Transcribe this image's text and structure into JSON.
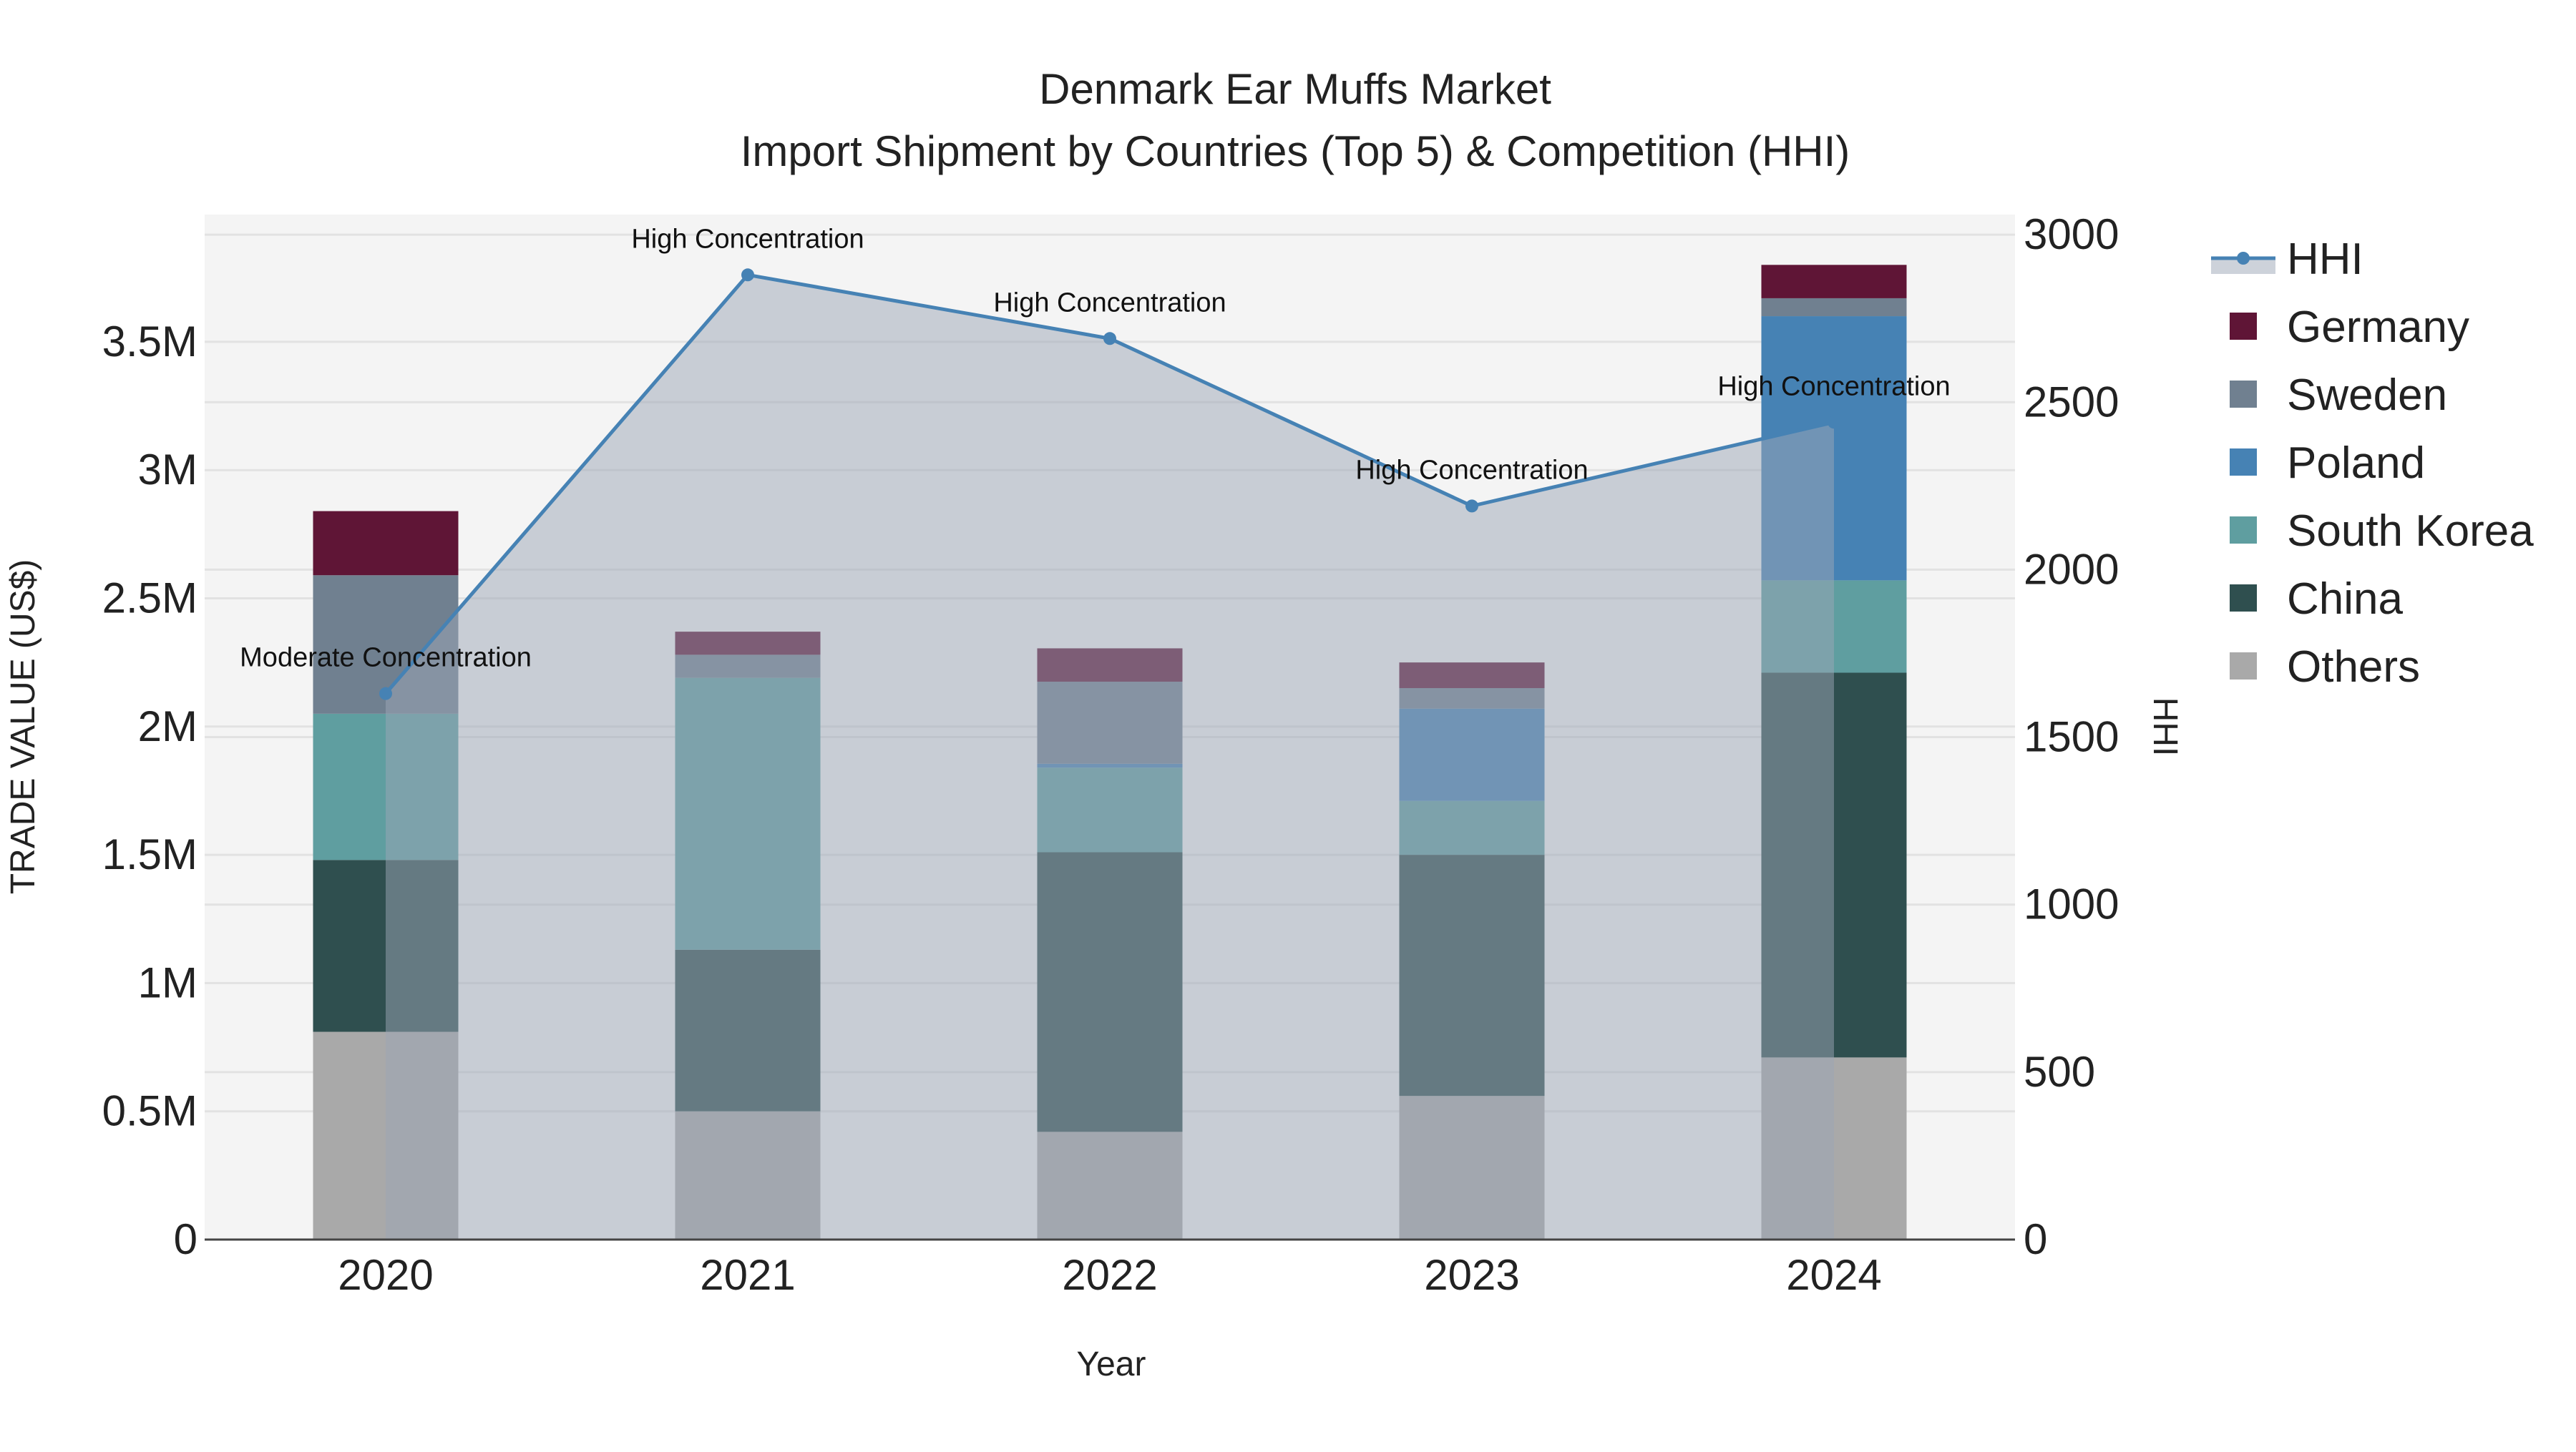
{
  "chart_data": {
    "type": "bar",
    "title": "Denmark Ear Muffs Market",
    "subtitle": "Import Shipment by Countries (Top 5) & Competition (HHI)",
    "xlabel": "Year",
    "ylabel": "TRADE VALUE (US$)",
    "y2label": "HHI",
    "categories": [
      "2020",
      "2021",
      "2022",
      "2023",
      "2024"
    ],
    "ylim": [
      0,
      3900000
    ],
    "y2lim": [
      0,
      3050
    ],
    "y_ticks": [
      0,
      500000,
      1000000,
      1500000,
      2000000,
      2500000,
      3000000,
      3500000
    ],
    "y_tick_labels": [
      "0",
      "0.5M",
      "1M",
      "1.5M",
      "2M",
      "2.5M",
      "3M",
      "3.5M"
    ],
    "y2_ticks": [
      0,
      500,
      1000,
      1500,
      2000,
      2500,
      3000
    ],
    "y2_tick_labels": [
      "0",
      "500",
      "1000",
      "1500",
      "2000",
      "2500",
      "3000"
    ],
    "series": [
      {
        "name": "Others",
        "color": "#a9a9a9",
        "values": [
          810000,
          500000,
          420000,
          560000,
          710000
        ]
      },
      {
        "name": "China",
        "color": "#2f4f4f",
        "values": [
          670000,
          630000,
          1090000,
          940000,
          1500000
        ]
      },
      {
        "name": "South Korea",
        "color": "#5f9ea0",
        "values": [
          570000,
          1060000,
          330000,
          210000,
          360000
        ]
      },
      {
        "name": "Poland",
        "color": "#4682b4",
        "values": [
          0,
          0,
          15000,
          360000,
          1030000
        ]
      },
      {
        "name": "Sweden",
        "color": "#708090",
        "values": [
          540000,
          90000,
          320000,
          80000,
          70000
        ]
      },
      {
        "name": "Germany",
        "color": "#5f1536",
        "values": [
          250000,
          90000,
          130000,
          100000,
          130000
        ]
      }
    ],
    "hhi": {
      "name": "HHI",
      "color": "#4682b4",
      "values": [
        1630,
        2880,
        2690,
        2190,
        2440
      ],
      "annotations": [
        "Moderate Concentration",
        "High Concentration",
        "High Concentration",
        "High Concentration",
        "High Concentration"
      ]
    },
    "legend": {
      "placement": "right",
      "items": [
        "HHI",
        "Germany",
        "Sweden",
        "Poland",
        "South Korea",
        "China",
        "Others"
      ]
    },
    "grid": true
  }
}
